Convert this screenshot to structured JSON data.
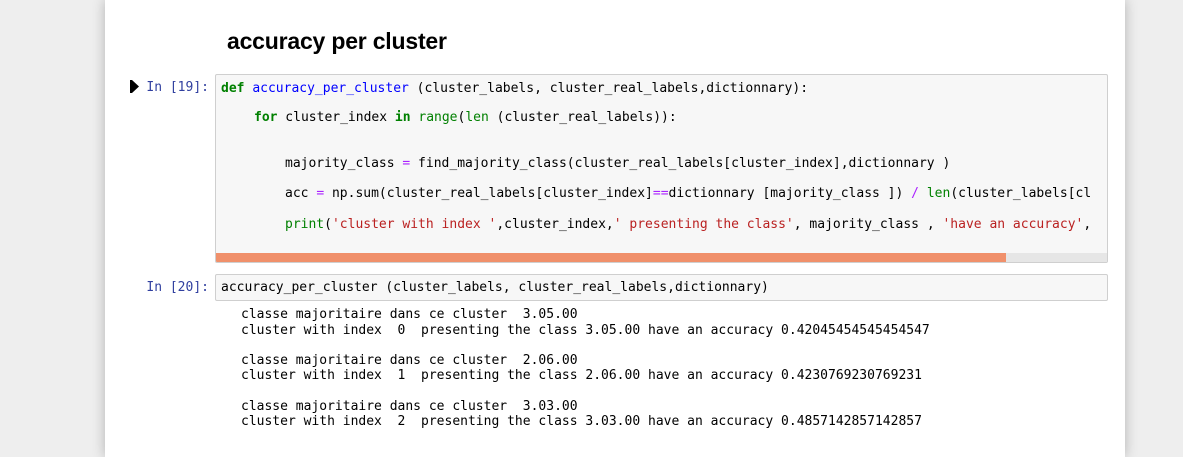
{
  "markdown": {
    "heading": "accuracy per cluster"
  },
  "cell19": {
    "prompt": "In [19]:",
    "line1": {
      "kw_def": "def",
      "name": "accuracy_per_cluster",
      "rest": " (cluster_labels, cluster_real_labels,dictionnary):"
    },
    "line2": {
      "kw_for": "for",
      "var": " cluster_index ",
      "kw_in": "in",
      "sp": " ",
      "range": "range",
      "p1": "(",
      "len": "len",
      "rest": " (cluster_real_labels)):"
    },
    "line3": {
      "lhs": "majority_class ",
      "eq": "=",
      "rest": " find_majority_class(cluster_real_labels[cluster_index],dictionnary )"
    },
    "line4": {
      "lhs": "acc ",
      "eq": "=",
      "a": " np.sum(cluster_real_labels[cluster_index]",
      "eqeq": "==",
      "b": "dictionnary [majority_class ]) ",
      "div": "/",
      "sp": " ",
      "len": "len",
      "c": "(cluster_labels[cl"
    },
    "line5": {
      "print": "print",
      "p": "(",
      "s1": "'cluster with index '",
      "a": ",cluster_index,",
      "s2": "' presenting the class'",
      "b": ", majority_class , ",
      "s3": "'have an accuracy'",
      "c": ","
    }
  },
  "cell20": {
    "prompt": "In [20]:",
    "code": "accuracy_per_cluster (cluster_labels, cluster_real_labels,dictionnary)",
    "output": [
      "classe majoritaire dans ce cluster  3.05.00",
      "cluster with index  0  presenting the class 3.05.00 have an accuracy 0.42045454545454547",
      "classe majoritaire dans ce cluster  2.06.00",
      "cluster with index  1  presenting the class 2.06.00 have an accuracy 0.4230769230769231",
      "classe majoritaire dans ce cluster  3.03.00",
      "cluster with index  2  presenting the class 3.03.00 have an accuracy 0.4857142857142857"
    ]
  },
  "icons": {
    "run": "run-cell-icon"
  },
  "colors": {
    "prompt": "#303f9f",
    "keyword": "#008000",
    "string": "#ba2121",
    "operator": "#aa22ff",
    "function": "#0000ff",
    "scrollbar": "#f0906b"
  }
}
